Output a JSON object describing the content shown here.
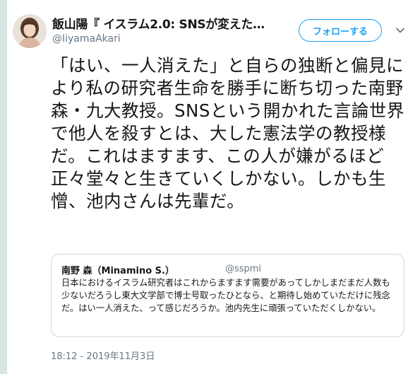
{
  "author": {
    "display_name": "飯山陽『 イスラム2.0: SNSが変えた…",
    "handle": "@IiyamaAkari"
  },
  "follow_button_label": "フォローする",
  "tweet_text": "「はい、一人消えた」と自らの独断と偏見により私の研究者生命を勝手に断ち切った南野森・九大教授。SNSという開かれた言論世界で他人を殺すとは、大した憲法学の教授様だ。これはますます、この人が嫌がるほど正々堂々と生きていくしかない。しかも生憎、池内さんは先輩だ。",
  "quoted_tweet": {
    "display_name": "南野 森（Minamino S.）",
    "handle": "@sspmi",
    "text": "日本におけるイスラム研究者はこれからますます需要があってしかしまだまだ人数も少ないだろうし東大文学部で博士号取ったひとなら、と期待し始めていただけに残念だ。はい一人消えた、って感じだろうか。池内先生に頑張っていただくしかない。"
  },
  "timestamp": "18:12 - 2019年11月3日",
  "icons": {
    "avatar": "profile-photo",
    "menu": "chevron-down-icon"
  },
  "colors": {
    "accent": "#1da1f2",
    "secondary_text": "#657786",
    "border": "#ccd6dd"
  }
}
